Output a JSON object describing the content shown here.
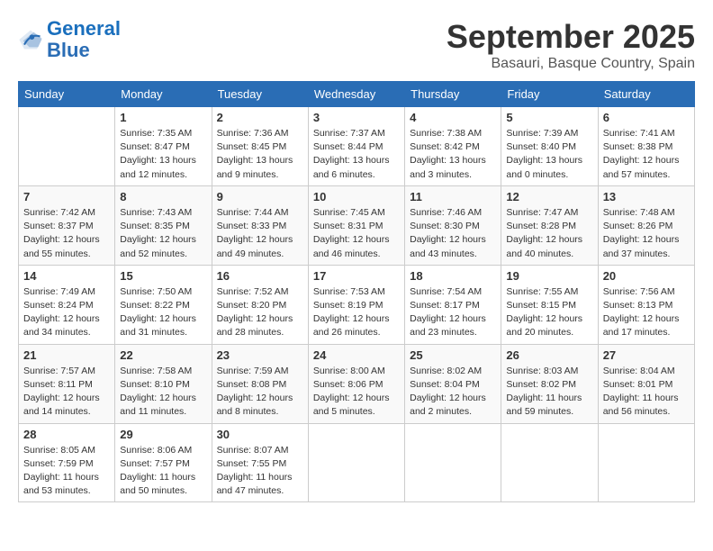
{
  "header": {
    "logo_line1": "General",
    "logo_line2": "Blue",
    "month_year": "September 2025",
    "location": "Basauri, Basque Country, Spain"
  },
  "days_of_week": [
    "Sunday",
    "Monday",
    "Tuesday",
    "Wednesday",
    "Thursday",
    "Friday",
    "Saturday"
  ],
  "weeks": [
    [
      {
        "day": "",
        "info": ""
      },
      {
        "day": "1",
        "info": "Sunrise: 7:35 AM\nSunset: 8:47 PM\nDaylight: 13 hours\nand 12 minutes."
      },
      {
        "day": "2",
        "info": "Sunrise: 7:36 AM\nSunset: 8:45 PM\nDaylight: 13 hours\nand 9 minutes."
      },
      {
        "day": "3",
        "info": "Sunrise: 7:37 AM\nSunset: 8:44 PM\nDaylight: 13 hours\nand 6 minutes."
      },
      {
        "day": "4",
        "info": "Sunrise: 7:38 AM\nSunset: 8:42 PM\nDaylight: 13 hours\nand 3 minutes."
      },
      {
        "day": "5",
        "info": "Sunrise: 7:39 AM\nSunset: 8:40 PM\nDaylight: 13 hours\nand 0 minutes."
      },
      {
        "day": "6",
        "info": "Sunrise: 7:41 AM\nSunset: 8:38 PM\nDaylight: 12 hours\nand 57 minutes."
      }
    ],
    [
      {
        "day": "7",
        "info": "Sunrise: 7:42 AM\nSunset: 8:37 PM\nDaylight: 12 hours\nand 55 minutes."
      },
      {
        "day": "8",
        "info": "Sunrise: 7:43 AM\nSunset: 8:35 PM\nDaylight: 12 hours\nand 52 minutes."
      },
      {
        "day": "9",
        "info": "Sunrise: 7:44 AM\nSunset: 8:33 PM\nDaylight: 12 hours\nand 49 minutes."
      },
      {
        "day": "10",
        "info": "Sunrise: 7:45 AM\nSunset: 8:31 PM\nDaylight: 12 hours\nand 46 minutes."
      },
      {
        "day": "11",
        "info": "Sunrise: 7:46 AM\nSunset: 8:30 PM\nDaylight: 12 hours\nand 43 minutes."
      },
      {
        "day": "12",
        "info": "Sunrise: 7:47 AM\nSunset: 8:28 PM\nDaylight: 12 hours\nand 40 minutes."
      },
      {
        "day": "13",
        "info": "Sunrise: 7:48 AM\nSunset: 8:26 PM\nDaylight: 12 hours\nand 37 minutes."
      }
    ],
    [
      {
        "day": "14",
        "info": "Sunrise: 7:49 AM\nSunset: 8:24 PM\nDaylight: 12 hours\nand 34 minutes."
      },
      {
        "day": "15",
        "info": "Sunrise: 7:50 AM\nSunset: 8:22 PM\nDaylight: 12 hours\nand 31 minutes."
      },
      {
        "day": "16",
        "info": "Sunrise: 7:52 AM\nSunset: 8:20 PM\nDaylight: 12 hours\nand 28 minutes."
      },
      {
        "day": "17",
        "info": "Sunrise: 7:53 AM\nSunset: 8:19 PM\nDaylight: 12 hours\nand 26 minutes."
      },
      {
        "day": "18",
        "info": "Sunrise: 7:54 AM\nSunset: 8:17 PM\nDaylight: 12 hours\nand 23 minutes."
      },
      {
        "day": "19",
        "info": "Sunrise: 7:55 AM\nSunset: 8:15 PM\nDaylight: 12 hours\nand 20 minutes."
      },
      {
        "day": "20",
        "info": "Sunrise: 7:56 AM\nSunset: 8:13 PM\nDaylight: 12 hours\nand 17 minutes."
      }
    ],
    [
      {
        "day": "21",
        "info": "Sunrise: 7:57 AM\nSunset: 8:11 PM\nDaylight: 12 hours\nand 14 minutes."
      },
      {
        "day": "22",
        "info": "Sunrise: 7:58 AM\nSunset: 8:10 PM\nDaylight: 12 hours\nand 11 minutes."
      },
      {
        "day": "23",
        "info": "Sunrise: 7:59 AM\nSunset: 8:08 PM\nDaylight: 12 hours\nand 8 minutes."
      },
      {
        "day": "24",
        "info": "Sunrise: 8:00 AM\nSunset: 8:06 PM\nDaylight: 12 hours\nand 5 minutes."
      },
      {
        "day": "25",
        "info": "Sunrise: 8:02 AM\nSunset: 8:04 PM\nDaylight: 12 hours\nand 2 minutes."
      },
      {
        "day": "26",
        "info": "Sunrise: 8:03 AM\nSunset: 8:02 PM\nDaylight: 11 hours\nand 59 minutes."
      },
      {
        "day": "27",
        "info": "Sunrise: 8:04 AM\nSunset: 8:01 PM\nDaylight: 11 hours\nand 56 minutes."
      }
    ],
    [
      {
        "day": "28",
        "info": "Sunrise: 8:05 AM\nSunset: 7:59 PM\nDaylight: 11 hours\nand 53 minutes."
      },
      {
        "day": "29",
        "info": "Sunrise: 8:06 AM\nSunset: 7:57 PM\nDaylight: 11 hours\nand 50 minutes."
      },
      {
        "day": "30",
        "info": "Sunrise: 8:07 AM\nSunset: 7:55 PM\nDaylight: 11 hours\nand 47 minutes."
      },
      {
        "day": "",
        "info": ""
      },
      {
        "day": "",
        "info": ""
      },
      {
        "day": "",
        "info": ""
      },
      {
        "day": "",
        "info": ""
      }
    ]
  ]
}
